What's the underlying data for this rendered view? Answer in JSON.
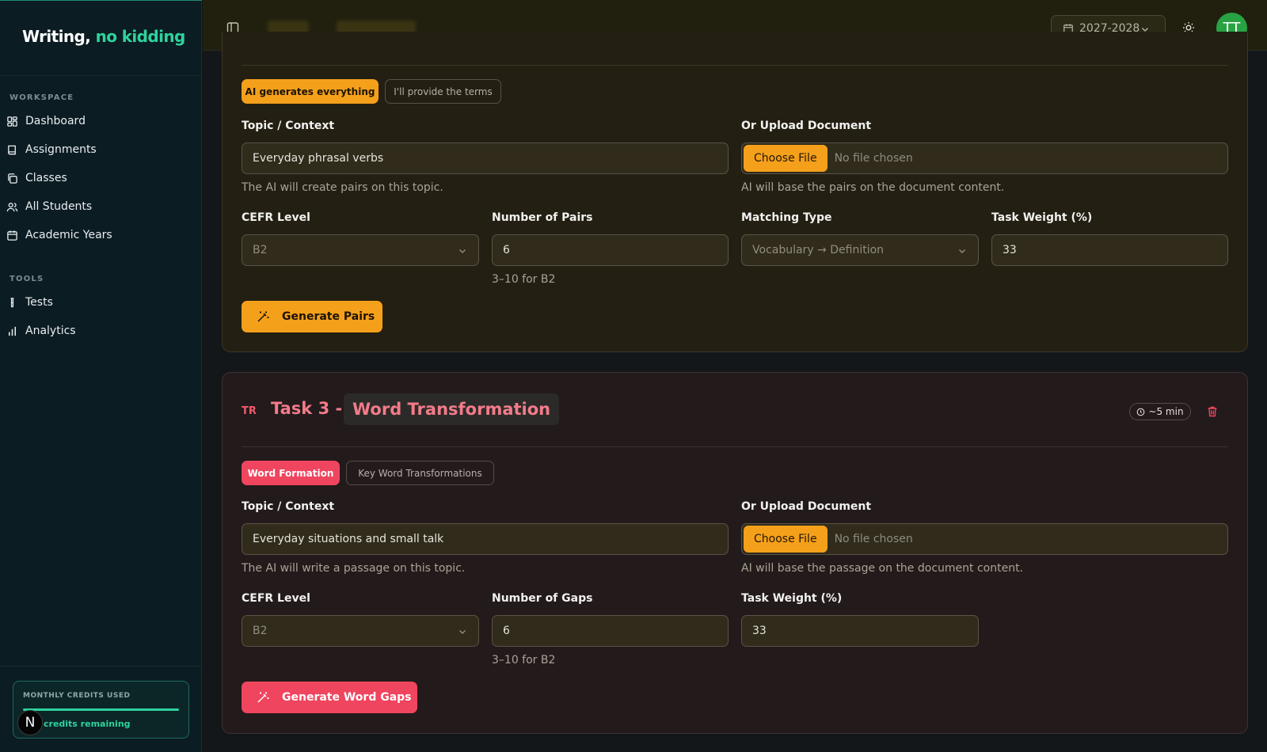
{
  "app": {
    "brand_main": "Writing,",
    "brand_accent": "no kidding"
  },
  "colors": {
    "brand_green": "#2ed39d",
    "amber": "#f5a01a",
    "rose": "#f0455f",
    "avatar_green": "#28a243"
  },
  "sidebar": {
    "workspace_label": "WORKSPACE",
    "workspace_items": [
      {
        "label": "Dashboard",
        "icon": "dashboard-icon"
      },
      {
        "label": "Assignments",
        "icon": "book-icon"
      },
      {
        "label": "Classes",
        "icon": "classes-icon"
      },
      {
        "label": "All Students",
        "icon": "users-icon"
      },
      {
        "label": "Academic Years",
        "icon": "calendar-icon"
      }
    ],
    "tools_label": "TOOLS",
    "tools_items": [
      {
        "label": "Tests",
        "icon": "test-tube-icon"
      },
      {
        "label": "Analytics",
        "icon": "bar-chart-icon"
      }
    ],
    "credits": {
      "label": "MONTHLY CREDITS USED",
      "remaining": "credits remaining",
      "badge": "N"
    }
  },
  "header": {
    "year": "2027-2028",
    "avatar": "TT"
  },
  "task2": {
    "mode_on": "AI generates everything",
    "mode_off": "I'll provide the terms",
    "topic_label": "Topic / Context",
    "topic_value": "Everyday phrasal verbs",
    "topic_hint": "The AI will create pairs on this topic.",
    "upload_label": "Or Upload Document",
    "choose_file": "Choose File",
    "no_file": "No file chosen",
    "upload_hint": "AI will base the pairs on the document content.",
    "cefr_label": "CEFR Level",
    "cefr_value": "B2",
    "count_label": "Number of Pairs",
    "count_value": "6",
    "count_hint": "3–10 for B2",
    "matching_label": "Matching Type",
    "matching_value": "Vocabulary → Definition",
    "weight_label": "Task Weight (%)",
    "weight_value": "33",
    "generate": "Generate Pairs"
  },
  "task3": {
    "code": "TR",
    "title_prefix": "Task 3 -",
    "title_name": "Word Transformation",
    "time": "~5 min",
    "mode_on": "Word Formation",
    "mode_off": "Key Word Transformations",
    "topic_label": "Topic / Context",
    "topic_value": "Everyday situations and small talk",
    "topic_hint": "The AI will write a passage on this topic.",
    "upload_label": "Or Upload Document",
    "choose_file": "Choose File",
    "no_file": "No file chosen",
    "upload_hint": "AI will base the passage on the document content.",
    "cefr_label": "CEFR Level",
    "cefr_value": "B2",
    "count_label": "Number of Gaps",
    "count_value": "6",
    "count_hint": "3–10 for B2",
    "weight_label": "Task Weight (%)",
    "weight_value": "33",
    "generate": "Generate Word Gaps"
  }
}
